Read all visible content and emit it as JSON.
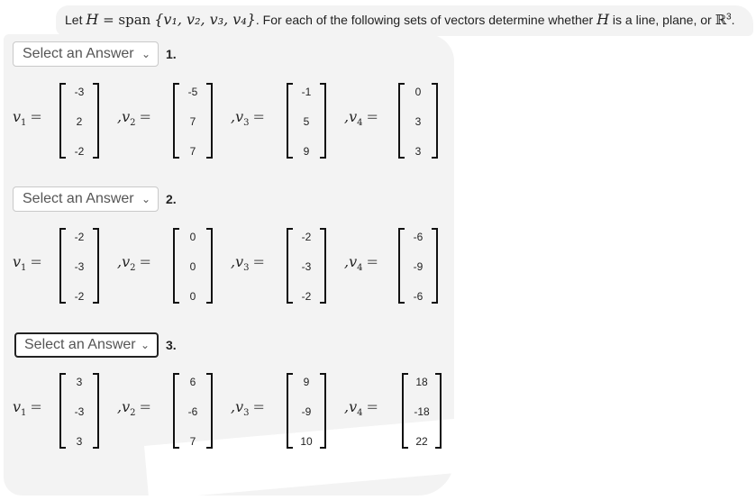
{
  "intro": {
    "prefix": "Let ",
    "H": "H",
    "eq": " = ",
    "span": "span",
    "set": "{v₁, v₂, v₃, v₄}",
    "middle": ". For each of the following sets of vectors determine whether ",
    "H2": "H",
    "suffix": " is a line, plane, or ",
    "R": "ℝ",
    "exp": "3",
    "end": "."
  },
  "questions": [
    {
      "number": "1.",
      "select": {
        "value": "Select an Answer",
        "focused": false
      },
      "vectors": [
        {
          "label": "v",
          "sub": "1",
          "values": [
            "-3",
            "2",
            "-2"
          ]
        },
        {
          "label": "v",
          "sub": "2",
          "values": [
            "-5",
            "7",
            "7"
          ]
        },
        {
          "label": "v",
          "sub": "3",
          "values": [
            "-1",
            "5",
            "9"
          ]
        },
        {
          "label": "v",
          "sub": "4",
          "values": [
            "0",
            "3",
            "3"
          ]
        }
      ]
    },
    {
      "number": "2.",
      "select": {
        "value": "Select an Answer",
        "focused": false
      },
      "vectors": [
        {
          "label": "v",
          "sub": "1",
          "values": [
            "-2",
            "-3",
            "-2"
          ]
        },
        {
          "label": "v",
          "sub": "2",
          "values": [
            "0",
            "0",
            "0"
          ]
        },
        {
          "label": "v",
          "sub": "3",
          "values": [
            "-2",
            "-3",
            "-2"
          ]
        },
        {
          "label": "v",
          "sub": "4",
          "values": [
            "-6",
            "-9",
            "-6"
          ]
        }
      ]
    },
    {
      "number": "3.",
      "select": {
        "value": "Select an Answer",
        "focused": true
      },
      "vectors": [
        {
          "label": "v",
          "sub": "1",
          "values": [
            "3",
            "-3",
            "3"
          ]
        },
        {
          "label": "v",
          "sub": "2",
          "values": [
            "6",
            "-6",
            "7"
          ]
        },
        {
          "label": "v",
          "sub": "3",
          "values": [
            "9",
            "-9",
            "10"
          ]
        },
        {
          "label": "v",
          "sub": "4",
          "values": [
            "18",
            "-18",
            "22"
          ]
        }
      ]
    }
  ],
  "icons": {
    "select_chevron": "chevron-down-icon"
  }
}
